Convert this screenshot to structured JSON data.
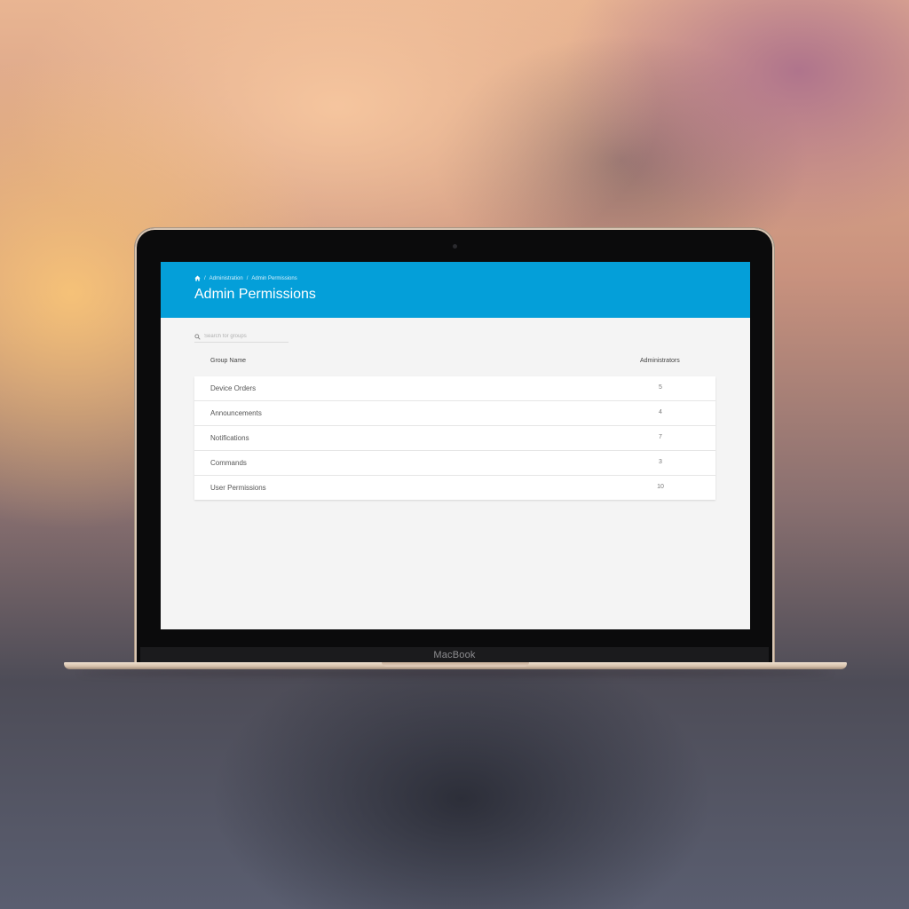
{
  "device": {
    "brand": "MacBook"
  },
  "breadcrumb": {
    "home_icon": "home-icon",
    "separator": "/",
    "items": [
      "Administration",
      "Admin Permissions"
    ]
  },
  "header": {
    "title": "Admin Permissions",
    "color": "#049fd9"
  },
  "search": {
    "placeholder": "Search for groups",
    "value": "",
    "icon": "search-icon"
  },
  "table": {
    "columns": {
      "name": "Group Name",
      "admins": "Administrators"
    },
    "rows": [
      {
        "name": "Device Orders",
        "admins": "5"
      },
      {
        "name": "Announcements",
        "admins": "4"
      },
      {
        "name": "Notifications",
        "admins": "7"
      },
      {
        "name": "Commands",
        "admins": "3"
      },
      {
        "name": "User Permissions",
        "admins": "10"
      }
    ]
  }
}
